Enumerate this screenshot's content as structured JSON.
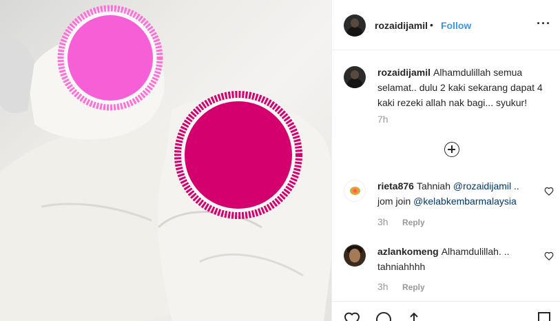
{
  "header": {
    "username": "rozaidijamil",
    "separator": "•",
    "follow_label": "Follow",
    "more_icon": "more-horizontal-icon"
  },
  "caption": {
    "username": "rozaidijamil",
    "text": "Alhamdulillah semua selamat.. dulu 2 kaki sekarang dapat 4 kaki rezeki allah nak bagi... syukur!",
    "time": "7h"
  },
  "load_more_icon": "plus-circle-icon",
  "comments": [
    {
      "username": "rieta876",
      "text_before": "Tahniah",
      "mention1": "@rozaidijamil",
      "text_middle": "..\njom join",
      "mention2": "@kelabkembarmalaysia",
      "time": "3h",
      "reply_label": "Reply"
    },
    {
      "username": "azlankomeng",
      "text": "Alhamdulillah. ..\ntahniahhhh",
      "time": "3h",
      "reply_label": "Reply"
    }
  ],
  "colors": {
    "link": "#3897f0",
    "mention": "#003569",
    "muted": "#999999",
    "sticker_pink": "#f65fd6",
    "sticker_magenta": "#d4006e"
  }
}
